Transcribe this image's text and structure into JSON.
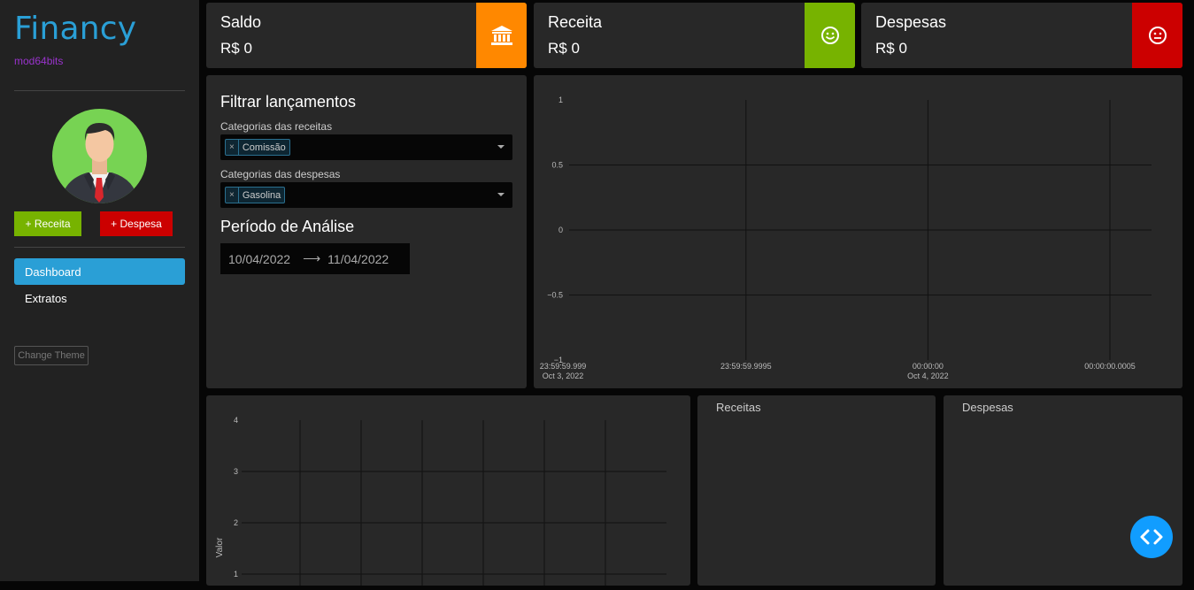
{
  "sidebar": {
    "brand": "Financy",
    "subtitle": "mod64bits",
    "add_income_label": "+ Receita",
    "add_expense_label": "+ Despesa",
    "nav": [
      {
        "label": "Dashboard",
        "active": true
      },
      {
        "label": "Extratos",
        "active": false
      }
    ],
    "theme_button": "Change Theme"
  },
  "stats": [
    {
      "title": "Saldo",
      "value": "R$ 0",
      "icon": "bank-icon",
      "color": "#ff8800"
    },
    {
      "title": "Receita",
      "value": "R$ 0",
      "icon": "smile-icon",
      "color": "#77b300"
    },
    {
      "title": "Despesas",
      "value": "R$ 0",
      "icon": "neutral-face-icon",
      "color": "#cc0000"
    }
  ],
  "filters": {
    "title": "Filtrar lançamentos",
    "income_label": "Categorias das receitas",
    "income_selected": "Comissão",
    "expense_label": "Categorias das despesas",
    "expense_selected": "Gasolina",
    "period_title": "Período de Análise",
    "start_date": "10/04/2022",
    "end_date": "11/04/2022"
  },
  "panels": {
    "income": "Receitas",
    "expense": "Despesas"
  },
  "chart_data": [
    {
      "type": "line",
      "title": "",
      "xlabel": "",
      "ylabel": "",
      "ylim": [
        -1,
        1
      ],
      "yticks": [
        "1",
        "0.5",
        "0",
        "−0.5",
        "−1"
      ],
      "xticks": [
        {
          "line1": "23:59:59.999",
          "line2": "Oct 3, 2022"
        },
        {
          "line1": "23:59:59.9995",
          "line2": ""
        },
        {
          "line1": "00:00:00",
          "line2": "Oct 4, 2022"
        },
        {
          "line1": "00:00:00.0005",
          "line2": ""
        }
      ],
      "series": [],
      "grid": true
    },
    {
      "type": "bar",
      "title": "",
      "xlabel": "",
      "ylabel": "Valor",
      "ylim": [
        0,
        4
      ],
      "yticks": [
        "4",
        "3",
        "2",
        "1"
      ],
      "series": [],
      "grid": true
    }
  ],
  "fab": {
    "icon": "code-brackets-icon"
  }
}
